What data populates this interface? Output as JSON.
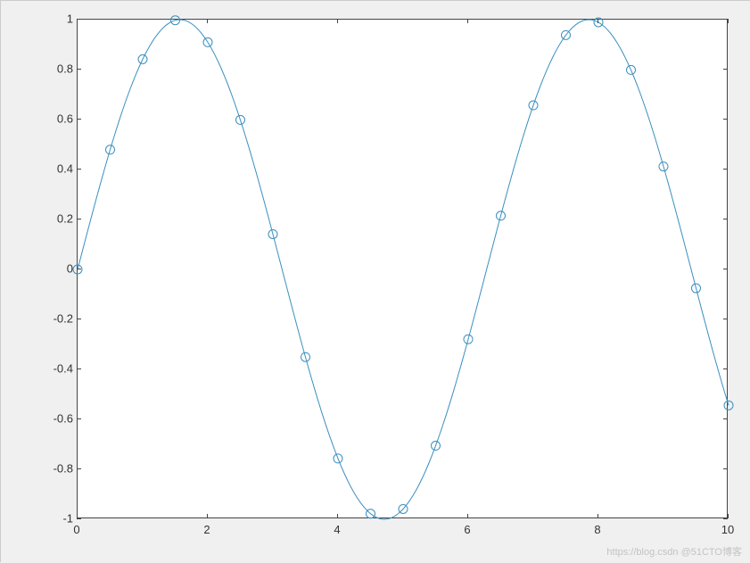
{
  "chart_data": {
    "type": "line",
    "x_line": [
      0,
      0.05,
      0.1,
      0.15,
      0.2,
      0.25,
      0.3,
      0.35,
      0.4,
      0.45,
      0.5,
      0.55,
      0.6,
      0.65,
      0.7,
      0.75,
      0.8,
      0.85,
      0.9,
      0.95,
      1,
      1.05,
      1.1,
      1.15,
      1.2,
      1.25,
      1.3,
      1.35,
      1.4,
      1.45,
      1.5,
      1.55,
      1.6,
      1.65,
      1.7,
      1.75,
      1.8,
      1.85,
      1.9,
      1.95,
      2,
      2.05,
      2.1,
      2.15,
      2.2,
      2.25,
      2.3,
      2.35,
      2.4,
      2.45,
      2.5,
      2.55,
      2.6,
      2.65,
      2.7,
      2.75,
      2.8,
      2.85,
      2.9,
      2.95,
      3,
      3.05,
      3.1,
      3.15,
      3.2,
      3.25,
      3.3,
      3.35,
      3.4,
      3.45,
      3.5,
      3.55,
      3.6,
      3.65,
      3.7,
      3.75,
      3.8,
      3.85,
      3.9,
      3.95,
      4,
      4.05,
      4.1,
      4.15,
      4.2,
      4.25,
      4.3,
      4.35,
      4.4,
      4.45,
      4.5,
      4.55,
      4.6,
      4.65,
      4.7,
      4.75,
      4.8,
      4.85,
      4.9,
      4.95,
      5,
      5.05,
      5.1,
      5.15,
      5.2,
      5.25,
      5.3,
      5.35,
      5.4,
      5.45,
      5.5,
      5.55,
      5.6,
      5.65,
      5.7,
      5.75,
      5.8,
      5.85,
      5.9,
      5.95,
      6,
      6.05,
      6.1,
      6.15,
      6.2,
      6.25,
      6.3,
      6.35,
      6.4,
      6.45,
      6.5,
      6.55,
      6.6,
      6.65,
      6.7,
      6.75,
      6.8,
      6.85,
      6.9,
      6.95,
      7,
      7.05,
      7.1,
      7.15,
      7.2,
      7.25,
      7.3,
      7.35,
      7.4,
      7.45,
      7.5,
      7.55,
      7.6,
      7.65,
      7.7,
      7.75,
      7.8,
      7.85,
      7.9,
      7.95,
      8,
      8.05,
      8.1,
      8.15,
      8.2,
      8.25,
      8.3,
      8.35,
      8.4,
      8.45,
      8.5,
      8.55,
      8.6,
      8.65,
      8.7,
      8.75,
      8.8,
      8.85,
      8.9,
      8.95,
      9,
      9.05,
      9.1,
      9.15,
      9.2,
      9.25,
      9.3,
      9.35,
      9.4,
      9.45,
      9.5,
      9.55,
      9.6,
      9.65,
      9.7,
      9.75,
      9.8,
      9.85,
      9.9,
      9.95,
      10
    ],
    "markers_x": [
      0,
      0.5,
      1,
      1.5,
      2,
      2.5,
      3,
      3.5,
      4,
      4.5,
      5,
      5.5,
      6,
      6.5,
      7,
      7.5,
      8,
      8.5,
      9,
      9.5,
      10
    ],
    "markers_y": [
      0,
      0.4794,
      0.8415,
      0.9975,
      0.9093,
      0.5985,
      0.1411,
      -0.3508,
      -0.7568,
      -0.9775,
      -0.9589,
      -0.7055,
      -0.2794,
      0.2151,
      0.657,
      0.938,
      0.9894,
      0.7985,
      0.4121,
      -0.0752,
      -0.544
    ],
    "xlim": [
      0,
      10
    ],
    "ylim": [
      -1,
      1
    ],
    "xticks": [
      0,
      2,
      4,
      6,
      8,
      10
    ],
    "yticks": [
      -1,
      -0.8,
      -0.6,
      -0.4,
      -0.2,
      0,
      0.2,
      0.4,
      0.6,
      0.8,
      1
    ],
    "xtick_labels": [
      "0",
      "2",
      "4",
      "6",
      "8",
      "10"
    ],
    "ytick_labels": [
      "-1",
      "-0.8",
      "-0.6",
      "-0.4",
      "-0.2",
      "0",
      "0.2",
      "0.4",
      "0.6",
      "0.8",
      "1"
    ],
    "line_color": "#3a8fbf",
    "marker_shape": "circle",
    "title": "",
    "xlabel": "",
    "ylabel": ""
  },
  "watermark": "https://blog.csdn @51CTO博客"
}
